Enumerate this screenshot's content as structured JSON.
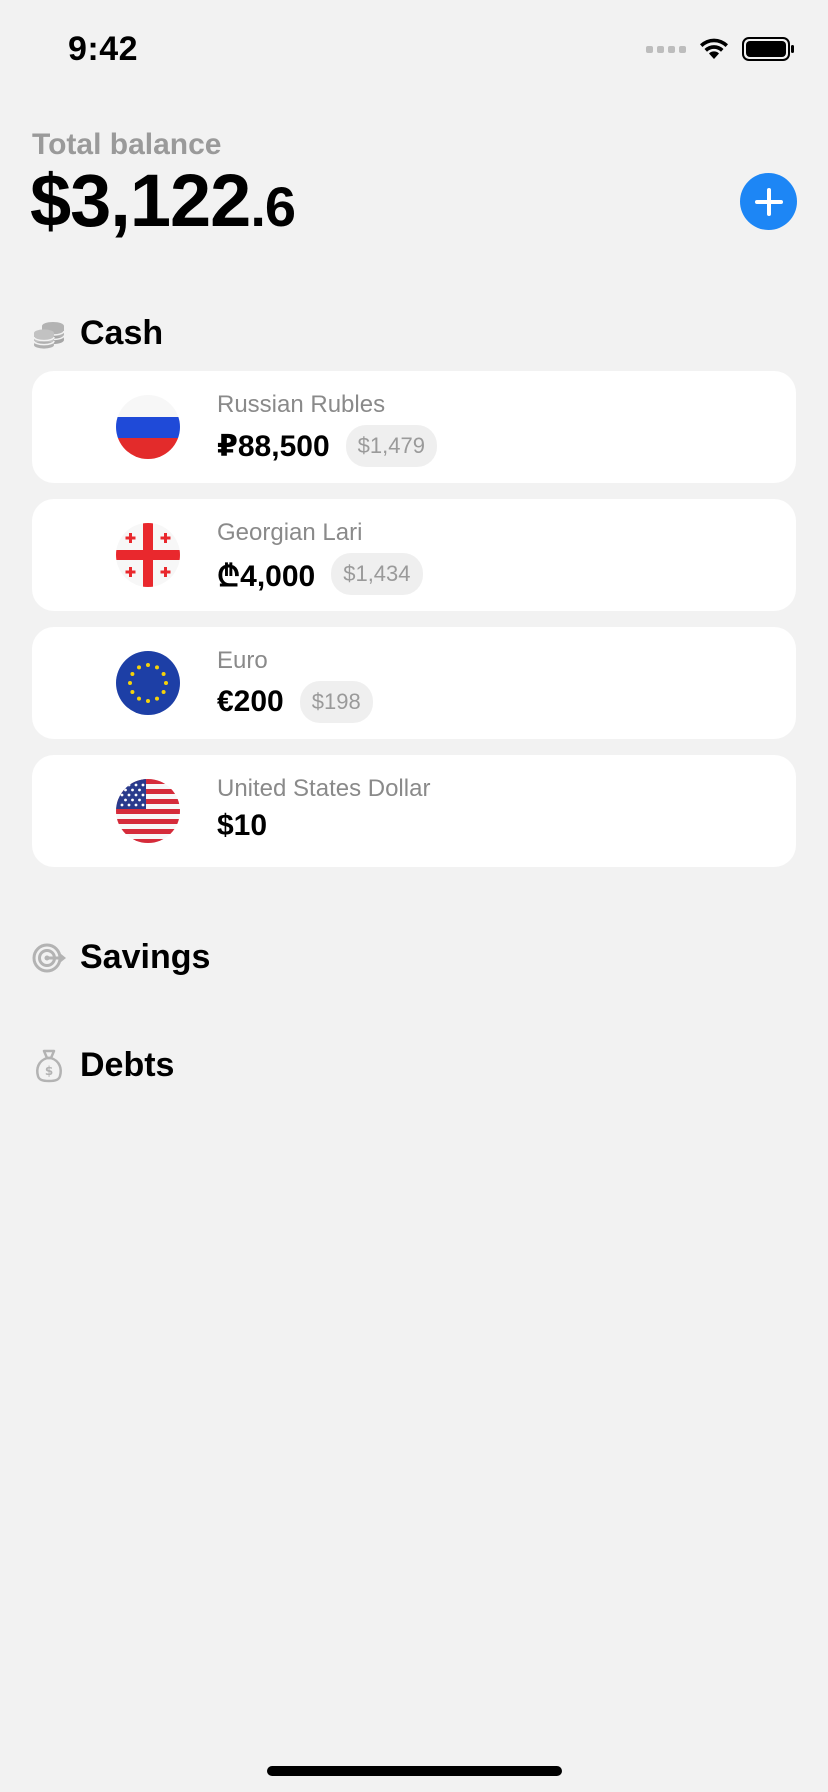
{
  "status": {
    "time": "9:42"
  },
  "balance": {
    "label": "Total balance",
    "whole": "$3,122",
    "decimal": ".6"
  },
  "sections": {
    "cash": {
      "label": "Cash",
      "icon": "coins-icon"
    },
    "savings": {
      "label": "Savings",
      "icon": "target-icon"
    },
    "debts": {
      "label": "Debts",
      "icon": "money-bag-icon"
    }
  },
  "accounts": [
    {
      "name": "Russian Rubles",
      "amount": "₽88,500",
      "converted": "$1,479",
      "flag": "russia-flag-icon"
    },
    {
      "name": "Georgian Lari",
      "amount": "₾4,000",
      "converted": "$1,434",
      "flag": "georgia-flag-icon"
    },
    {
      "name": "Euro",
      "amount": "€200",
      "converted": "$198",
      "flag": "eu-flag-icon"
    },
    {
      "name": "United States Dollar",
      "amount": "$10",
      "converted": "",
      "flag": "usa-flag-icon"
    }
  ],
  "colors": {
    "accent": "#1d86f5",
    "background": "#f2f2f2",
    "card": "#ffffff",
    "muted": "#8a8a8a"
  }
}
